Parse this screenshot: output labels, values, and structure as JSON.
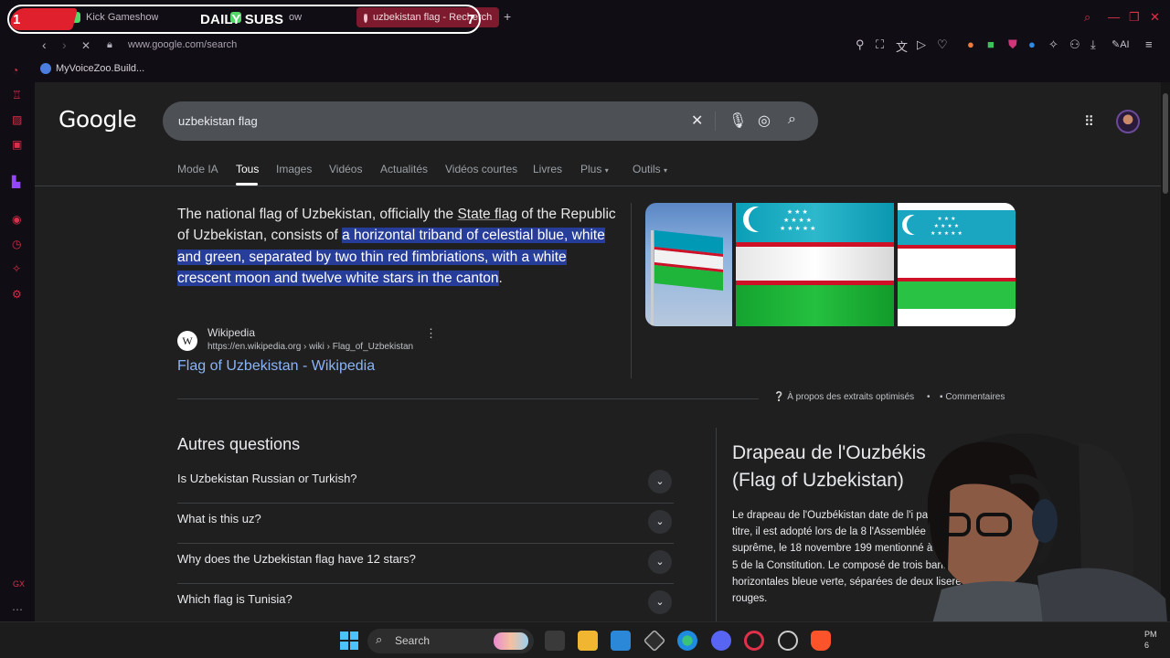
{
  "overlay": {
    "left_number": "1",
    "title": "DAILY SUBS",
    "right_number": "7"
  },
  "browser": {
    "tabs": [
      {
        "label": "Kick Gameshow"
      },
      {
        "label": "ow"
      },
      {
        "label": "uzbekistan flag - Recherch"
      }
    ],
    "url": "www.google.com/search",
    "bookmark": "MyVoiceZoo.Build...",
    "ai_label": "AI",
    "rail_bottom_label": "GX"
  },
  "google": {
    "logo": "Google",
    "query": "uzbekistan flag",
    "tabs": [
      "Mode IA",
      "Tous",
      "Images",
      "Vidéos",
      "Actualités",
      "Vidéos courtes",
      "Livres",
      "Plus",
      "Outils"
    ],
    "snippet": {
      "part1": "The national flag of Uzbekistan, officially the ",
      "link": "State flag",
      "part2": " of the Republic of Uzbekistan, consists of ",
      "highlight": "a horizontal triband of celestial blue, white and green, separated by two thin red fimbriations, with a white crescent moon and twelve white stars in the canton",
      "part3": "."
    },
    "source_icon": "W",
    "source_name": "Wikipedia",
    "source_url": "https://en.wikipedia.org › wiki › Flag_of_Uzbekistan",
    "result_title": "Flag of Uzbekistan - Wikipedia",
    "about_snippets": "À propos des extraits optimisés",
    "feedback": "Commentaires",
    "other_questions_title": "Autres questions",
    "questions": [
      "Is Uzbekistan Russian or Turkish?",
      "What is this uz?",
      "Why does the Uzbekistan flag have 12 stars?",
      "Which flag is Tunisia?"
    ],
    "knowledge_panel": {
      "title": "Drapeau de l'Ouzbékis (Flag of Uzbekistan)",
      "text": "Le drapeau de l'Ouzbékistan date de l'i pays. À ce titre, il est adopté lors de la 8 l'Assemblée suprême, le 18 novembre 199 mentionné à l'Article 5 de la Constitution. Le composé de trois bandes horizontales bleue verte, séparées de deux liserés rouges."
    }
  },
  "taskbar": {
    "search_label": "Search",
    "clock": "PM\n6"
  },
  "colors": {
    "flag_blue": "#0099b5",
    "flag_white": "#ffffff",
    "flag_green": "#1eb53a",
    "flag_red": "#ce1126",
    "link_blue": "#8ab4f8",
    "highlight": "#273d9a",
    "opera_red": "#e0304a"
  }
}
